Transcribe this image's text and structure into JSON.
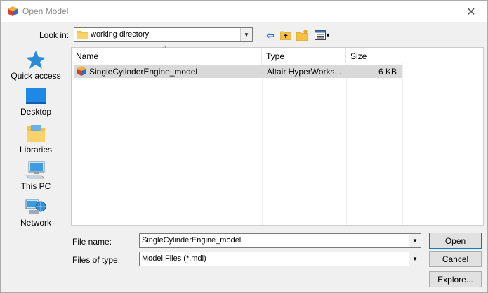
{
  "window": {
    "title": "Open Model",
    "close_glyph": "✕"
  },
  "lookin": {
    "label": "Look in:",
    "value": "working directory"
  },
  "toolbar": {
    "back_glyph": "⇦",
    "view_glyph": "▾"
  },
  "places": [
    {
      "label": "Quick access",
      "icon": "quick-access-star-icon"
    },
    {
      "label": "Desktop",
      "icon": "desktop-icon"
    },
    {
      "label": "Libraries",
      "icon": "libraries-icon"
    },
    {
      "label": "This PC",
      "icon": "computer-icon"
    },
    {
      "label": "Network",
      "icon": "network-icon"
    }
  ],
  "filelist": {
    "columns": [
      "Name",
      "Type",
      "Size"
    ],
    "sort_glyph": "^",
    "rows": [
      {
        "name": "SingleCylinderEngine_model",
        "type": "Altair HyperWorks...",
        "size": "6 KB"
      }
    ]
  },
  "filename": {
    "label": "File name:",
    "value": "SingleCylinderEngine_model"
  },
  "filetype": {
    "label": "Files of type:",
    "value": "Model Files (*.mdl)"
  },
  "buttons": {
    "open": "Open",
    "cancel": "Cancel",
    "explore": "Explore..."
  },
  "colors": {
    "accent": "#0078d7",
    "selected_row": "#d9d9d9",
    "folder": "#f6c143"
  }
}
